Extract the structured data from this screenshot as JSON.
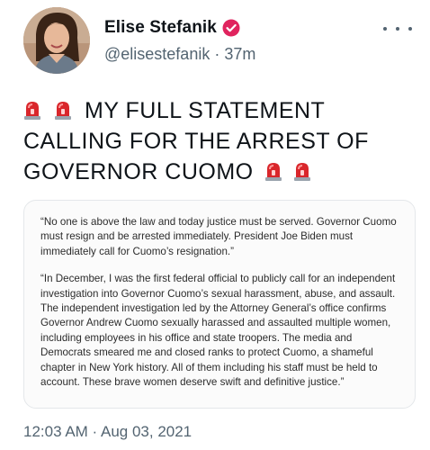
{
  "author": {
    "display_name": "Elise Stefanik",
    "handle": "@elisestefanik",
    "separator": " · ",
    "time_ago": "37m",
    "verified_icon": "verified-badge-icon",
    "avatar_icon": "avatar-photo"
  },
  "menu": {
    "icon": "more-options-icon"
  },
  "tweet": {
    "line1": "MY FULL STATEMENT",
    "line2": "CALLING FOR THE ARREST OF",
    "line3": "GOVERNOR CUOMO",
    "emoji": "police-siren-icon"
  },
  "statement": {
    "paragraph1": "“No one is above the law and today justice must be served. Governor Cuomo must resign and be arrested immediately. President Joe Biden must immediately call for Cuomo’s resignation.”",
    "paragraph2": "“In December, I was the first federal official to publicly call for an independent investigation into Governor Cuomo’s sexual harassment, abuse, and assault. The independent investigation led by the Attorney General’s office confirms Governor Andrew Cuomo sexually harassed and assaulted multiple women, including employees in his office and state troopers. The media and Democrats smeared me and closed ranks to protect Cuomo, a shameful chapter in New York history. All of them including his staff must be held to account. These brave women deserve swift and definitive justice.”"
  },
  "footer": {
    "timestamp": "12:03 AM · Aug 03, 2021"
  },
  "colors": {
    "verified_red": "#e0245e",
    "secondary_text": "#536471",
    "siren_red": "#d9262b"
  }
}
